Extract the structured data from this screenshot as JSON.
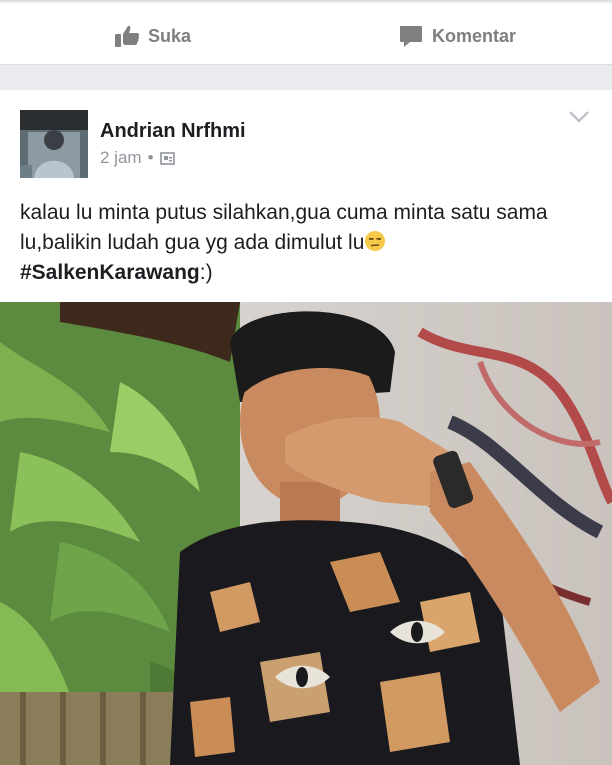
{
  "actions": {
    "like_label": "Suka",
    "comment_label": "Komentar"
  },
  "post": {
    "author": "Andrian Nrfhmi",
    "time": "2 jam",
    "separator": "•",
    "privacy_icon": "friends-album-icon",
    "text_line1": "kalau lu minta putus silahkan,gua cuma minta satu sama lu,balikin ludah gua yg ada dimulut lu",
    "emoji": "😒",
    "hashtag": "#SalkenKarawang",
    "hashtag_suffix": ":)"
  },
  "colors": {
    "facebook_gray_text": "#7f7f7f",
    "meta_text": "#90949c",
    "feed_background": "#e9ebee",
    "link_text": "#1c1e21"
  }
}
